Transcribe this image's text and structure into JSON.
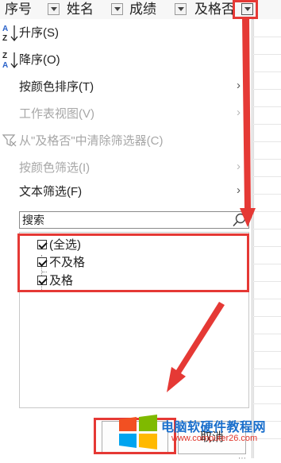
{
  "header": {
    "columns": [
      {
        "label": "序号"
      },
      {
        "label": "姓名"
      },
      {
        "label": "成绩"
      },
      {
        "label": "及格否"
      }
    ]
  },
  "menu": {
    "sort_asc": "升序(S)",
    "sort_desc": "降序(O)",
    "sort_by_color": "按颜色排序(T)",
    "sheet_view": "工作表视图(V)",
    "clear_filter": "从\"及格否\"中清除筛选器(C)",
    "filter_by_color": "按颜色筛选(I)",
    "text_filter": "文本筛选(F)"
  },
  "search": {
    "placeholder": "搜索"
  },
  "filter_list": {
    "items": [
      {
        "label": "(全选)",
        "checked": true
      },
      {
        "label": "不及格",
        "checked": true
      },
      {
        "label": "及格",
        "checked": true
      }
    ]
  },
  "buttons": {
    "cancel": "取消"
  },
  "watermark": {
    "title": "电脑软硬件教程网",
    "url": "www.computer26.com"
  },
  "colors": {
    "highlight_red": "#e53935",
    "watermark_blue": "#1a6fcc"
  }
}
